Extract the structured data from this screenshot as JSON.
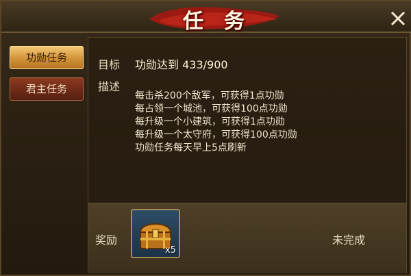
{
  "window": {
    "title": "任务"
  },
  "sidebar": {
    "tabs": [
      {
        "label": "功勋任务",
        "active": true
      },
      {
        "label": "君主任务",
        "active": false
      }
    ]
  },
  "task": {
    "goal_label": "目标",
    "goal_text": "功勋达到 433/900",
    "goal_current": 433,
    "goal_target": 900,
    "desc_label": "描述",
    "desc_lines": [
      "每击杀200个敌军，可获得1点功勋",
      "每占领一个城池，可获得100点功勋",
      "每升级一个小建筑，可获得1点功勋",
      "每升级一个太守府，可获得100点功勋",
      "功勋任务每天早上5点刷新"
    ]
  },
  "reward": {
    "label": "奖励",
    "item_icon": "treasure-chest-icon",
    "item_count": "x5",
    "status": "未完成"
  },
  "colors": {
    "accent_gold": "#d2943a",
    "banner_red": "#9b1b12",
    "text_cream": "#f1e6cf"
  }
}
